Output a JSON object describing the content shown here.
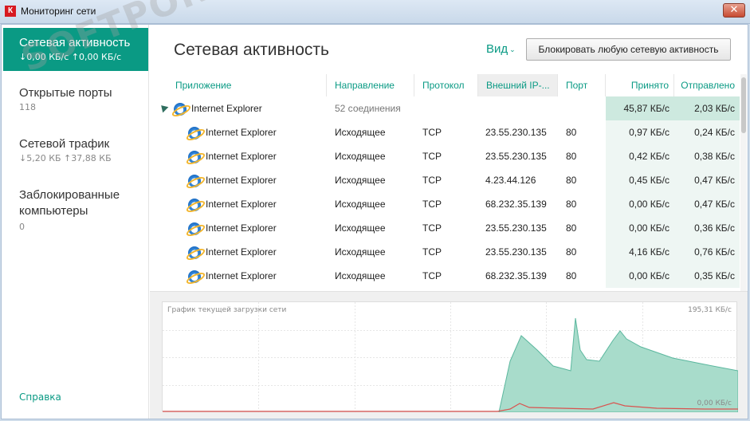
{
  "window": {
    "title": "Мониторинг сети",
    "logo": "К",
    "close_glyph": "✕"
  },
  "sidebar": {
    "items": [
      {
        "label": "Сетевая активность",
        "sub": "↓0,00 КБ/с ↑0,00 КБ/с"
      },
      {
        "label": "Открытые порты",
        "sub": "118"
      },
      {
        "label": "Сетевой трафик",
        "sub": "↓5,20 КБ ↑37,88 КБ"
      },
      {
        "label": "Заблокированные компьютеры",
        "sub": "0"
      }
    ],
    "help": "Справка"
  },
  "main": {
    "title": "Сетевая активность",
    "view_label": "Вид",
    "view_chevron": "⌄",
    "block_button": "Блокировать любую сетевую активность"
  },
  "table": {
    "headers": {
      "app": "Приложение",
      "direction": "Направление",
      "protocol": "Протокол",
      "external_ip": "Внешний IP-...",
      "port": "Порт",
      "received": "Принято",
      "sent": "Отправлено"
    },
    "parent": {
      "app": "Internet Explorer",
      "connections": "52 соединения",
      "received": "45,87 КБ/с",
      "sent": "2,03 КБ/с"
    },
    "rows": [
      {
        "app": "Internet Explorer",
        "direction": "Исходящее",
        "protocol": "TCP",
        "ip": "23.55.230.135",
        "port": "80",
        "received": "0,97 КБ/с",
        "sent": "0,24 КБ/с"
      },
      {
        "app": "Internet Explorer",
        "direction": "Исходящее",
        "protocol": "TCP",
        "ip": "23.55.230.135",
        "port": "80",
        "received": "0,42 КБ/с",
        "sent": "0,38 КБ/с"
      },
      {
        "app": "Internet Explorer",
        "direction": "Исходящее",
        "protocol": "TCP",
        "ip": "4.23.44.126",
        "port": "80",
        "received": "0,45 КБ/с",
        "sent": "0,47 КБ/с"
      },
      {
        "app": "Internet Explorer",
        "direction": "Исходящее",
        "protocol": "TCP",
        "ip": "68.232.35.139",
        "port": "80",
        "received": "0,00 КБ/с",
        "sent": "0,47 КБ/с"
      },
      {
        "app": "Internet Explorer",
        "direction": "Исходящее",
        "protocol": "TCP",
        "ip": "23.55.230.135",
        "port": "80",
        "received": "0,00 КБ/с",
        "sent": "0,36 КБ/с"
      },
      {
        "app": "Internet Explorer",
        "direction": "Исходящее",
        "protocol": "TCP",
        "ip": "23.55.230.135",
        "port": "80",
        "received": "4,16 КБ/с",
        "sent": "0,76 КБ/с"
      },
      {
        "app": "Internet Explorer",
        "direction": "Исходящее",
        "protocol": "TCP",
        "ip": "68.232.35.139",
        "port": "80",
        "received": "0,00 КБ/с",
        "sent": "0,35 КБ/с"
      }
    ]
  },
  "chart": {
    "title": "График текущей загрузки сети",
    "max_label": "195,31 КБ/с",
    "min_label": "0,00 КБ/с",
    "colors": {
      "received": "#a8dccb",
      "received_line": "#5bb79e",
      "sent": "#d9534f",
      "grid": "#e6e6e6"
    }
  },
  "watermark": "SOFTPORTAL"
}
